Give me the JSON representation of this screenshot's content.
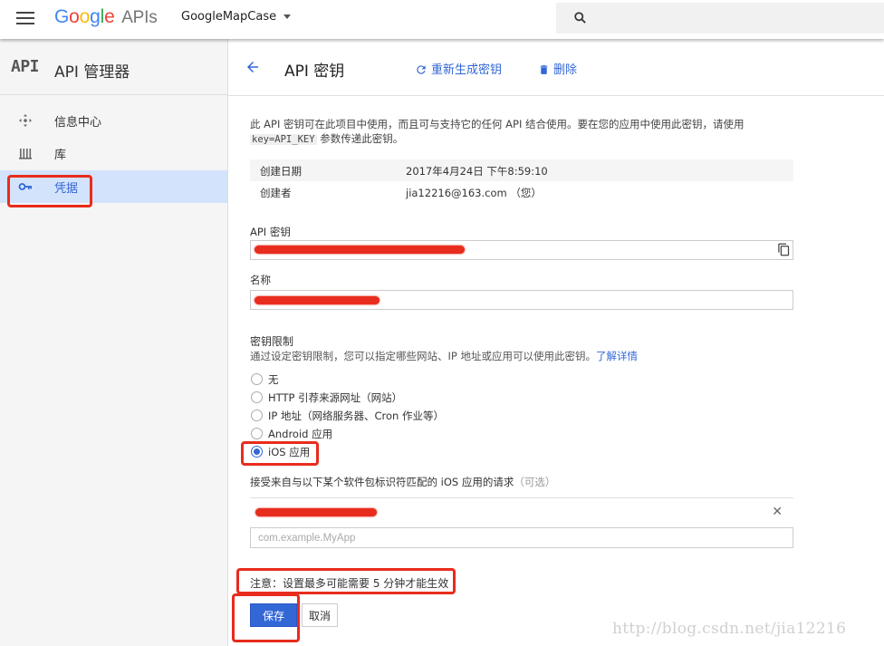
{
  "topbar": {
    "logo_google": [
      "G",
      "o",
      "o",
      "g",
      "l",
      "e"
    ],
    "logo_apis": "APIs",
    "project_name": "GoogleMapCase"
  },
  "sidebar": {
    "brand_icon_text": "API",
    "title": "API 管理器",
    "items": [
      {
        "label": "信息中心",
        "icon": "dashboard-icon"
      },
      {
        "label": "库",
        "icon": "library-icon"
      },
      {
        "label": "凭据",
        "icon": "key-icon",
        "active": true
      }
    ]
  },
  "header": {
    "title": "API 密钥",
    "regenerate_label": "重新生成密钥",
    "delete_label": "删除"
  },
  "description": {
    "part1": "此 API 密钥可在此项目中使用，而且可与支持它的任何 API 结合使用。要在您的应用中使用此密钥，请使用",
    "code": "key=API_KEY",
    "part2": " 参数传递此密钥。"
  },
  "meta": {
    "created_label": "创建日期",
    "created_value": "2017年4月24日 下午8:59:10",
    "creator_label": "创建者",
    "creator_value": "jia12216@163.com （您）"
  },
  "fields": {
    "api_key_label": "API 密钥",
    "name_label": "名称"
  },
  "restriction": {
    "title": "密钥限制",
    "subtitle": "通过设定密钥限制，您可以指定哪些网站、IP 地址或应用可以使用此密钥。",
    "learn_more": "了解详情",
    "options": [
      {
        "label": "无",
        "checked": false
      },
      {
        "label": "HTTP 引荐来源网址（网站）",
        "checked": false
      },
      {
        "label": "IP 地址（网络服务器、Cron 作业等）",
        "checked": false
      },
      {
        "label": "Android 应用",
        "checked": false
      },
      {
        "label": "iOS 应用",
        "checked": true
      }
    ]
  },
  "bundle": {
    "label": "接受来自与以下某个软件包标识符匹配的 iOS 应用的请求",
    "optional": "（可选）",
    "placeholder": "com.example.MyApp"
  },
  "note": "注意：设置最多可能需要 5 分钟才能生效",
  "actions": {
    "save": "保存",
    "cancel": "取消"
  },
  "watermark": "http://blog.csdn.net/jia12216",
  "colors": {
    "accent": "#3367d6",
    "highlight": "#e82c1d",
    "sidebar_active": "#d3e3fc"
  }
}
